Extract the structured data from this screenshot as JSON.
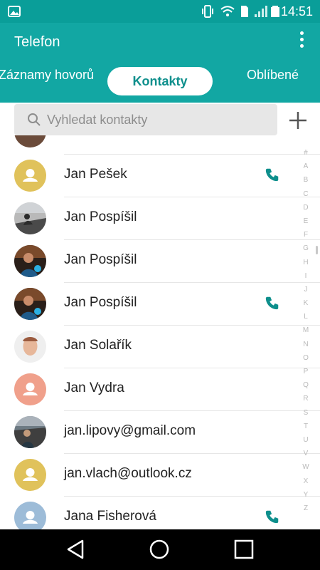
{
  "status": {
    "time": "14:51"
  },
  "app": {
    "title": "Telefon"
  },
  "tabs": [
    {
      "label": "Záznamy hovorů"
    },
    {
      "label": "Kontakty"
    },
    {
      "label": "Oblíbené"
    }
  ],
  "search": {
    "placeholder": "Vyhledat kontakty"
  },
  "contacts": [
    {
      "name": "Jan Pešek",
      "avatar": "yellow-default",
      "call": true
    },
    {
      "name": "Jan Pospíšil",
      "avatar": "photo-bike",
      "call": false
    },
    {
      "name": "Jan Pospíšil",
      "avatar": "photo-person",
      "call": false
    },
    {
      "name": "Jan Pospíšil",
      "avatar": "photo-person",
      "call": true
    },
    {
      "name": "Jan Solařík",
      "avatar": "photo-face",
      "call": false
    },
    {
      "name": "Jan Vydra",
      "avatar": "orange-default",
      "call": false
    },
    {
      "name": "jan.lipovy@gmail.com",
      "avatar": "photo-outdoor",
      "call": false
    },
    {
      "name": "jan.vlach@outlook.cz",
      "avatar": "yellow-default",
      "call": false
    },
    {
      "name": "Jana Fisherová",
      "avatar": "blue-default",
      "call": true
    }
  ],
  "index_letters": [
    "#",
    "A",
    "B",
    "C",
    "D",
    "E",
    "F",
    "G",
    "H",
    "I",
    "J",
    "K",
    "L",
    "M",
    "N",
    "O",
    "P",
    "Q",
    "R",
    "S",
    "T",
    "U",
    "V",
    "W",
    "X",
    "Y",
    "Z"
  ],
  "colors": {
    "status_bar": "#0a9e99",
    "app_bar": "#12a7a3",
    "accent": "#0e8f8c",
    "yellow_avatar": "#e0c25b",
    "orange_avatar": "#f0a08b",
    "blue_avatar": "#9dbcd8"
  }
}
